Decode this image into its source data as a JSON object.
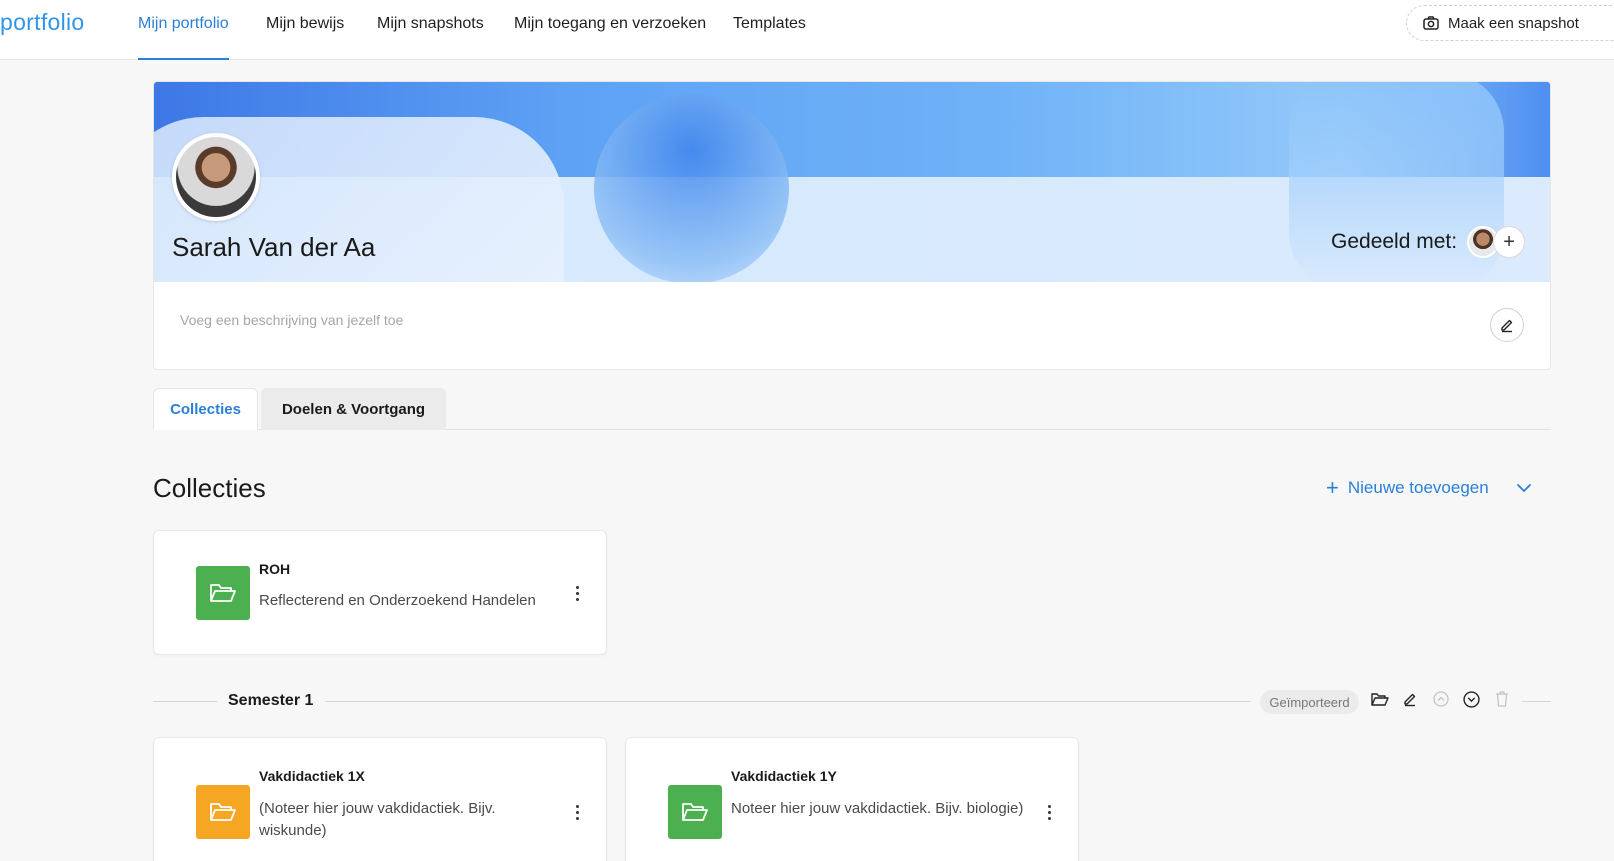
{
  "nav": {
    "logo": "portfolio",
    "items": [
      {
        "label": "Mijn portfolio",
        "active": true
      },
      {
        "label": "Mijn bewijs"
      },
      {
        "label": "Mijn snapshots"
      },
      {
        "label": "Mijn toegang en verzoeken"
      },
      {
        "label": "Templates"
      }
    ],
    "snapshot_button": "Maak een snapshot"
  },
  "profile": {
    "name": "Sarah Van der Aa",
    "shared_label": "Gedeeld met:",
    "description_placeholder": "Voeg een beschrijving van jezelf toe"
  },
  "tabs": [
    {
      "label": "Collecties",
      "active": true
    },
    {
      "label": "Doelen & Voortgang"
    }
  ],
  "section": {
    "title": "Collecties",
    "add_new": "Nieuwe toevoegen"
  },
  "collections": [
    {
      "title": "ROH",
      "description": "Reflecterend en Onderzoekend Handelen",
      "color": "#4caf50"
    }
  ],
  "semester": {
    "title": "Semester 1",
    "badge": "Geïmporteerd",
    "collections": [
      {
        "title": "Vakdidactiek 1X",
        "description": "(Noteer hier jouw vakdidactiek. Bijv. wiskunde)",
        "color": "#f5a623"
      },
      {
        "title": "Vakdidactiek 1Y",
        "description": "Noteer hier jouw vakdidactiek. Bijv. biologie)",
        "color": "#4caf50"
      }
    ]
  },
  "colors": {
    "accent": "#2a7fd8",
    "logo": "#2f95e8",
    "green_folder": "#4caf50",
    "orange_folder": "#f5a623"
  }
}
